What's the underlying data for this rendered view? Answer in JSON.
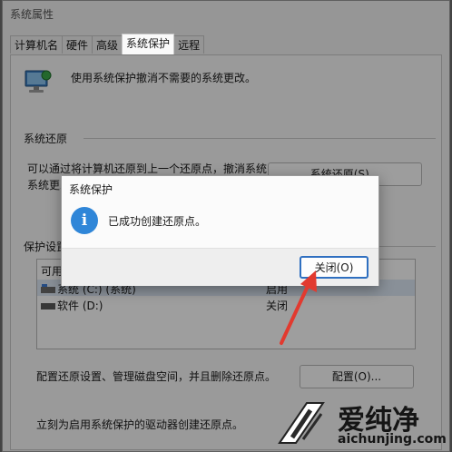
{
  "window": {
    "title": "系统属性"
  },
  "tabs": [
    {
      "label": "计算机名"
    },
    {
      "label": "硬件"
    },
    {
      "label": "高级"
    },
    {
      "label": "系统保护"
    },
    {
      "label": "远程"
    }
  ],
  "intro": {
    "text": "使用系统保护撤消不需要的系统更改。"
  },
  "restore": {
    "section_title": "系统还原",
    "desc_line1": "可以通过将计算机还原到上一个还原点，撤消系统",
    "desc_line2": "系统更改",
    "button_label": "系统还原(S)..."
  },
  "protection": {
    "section_title": "保护设置",
    "table": {
      "header_col1": "可用驱动器",
      "rows": [
        {
          "drive": "系统 (C:) (系统)",
          "status": "启用"
        },
        {
          "drive": "软件 (D:)",
          "status": "关闭"
        }
      ]
    },
    "configure_text": "配置还原设置、管理磁盘空间，并且删除还原点。",
    "configure_button": "配置(O)...",
    "create_text": "立刻为启用系统保护的驱动器创建还原点。"
  },
  "dialog": {
    "title": "系统保护",
    "message": "已成功创建还原点。",
    "close_button": "关闭(O)",
    "info_icon_glyph": "i",
    "accent_color": "#2f86d8"
  },
  "annotation": {
    "arrow_color": "#e23a2f"
  },
  "watermark": {
    "brand": "爱纯净",
    "url": "aichunjing.com"
  }
}
